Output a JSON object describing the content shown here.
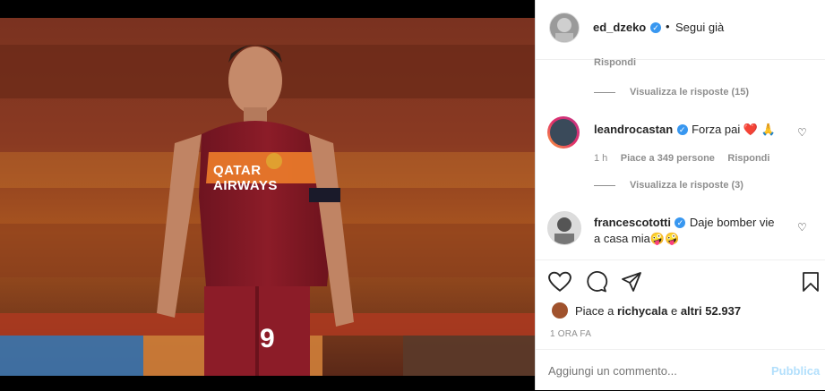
{
  "post": {
    "author": "ed_dzeko",
    "dot": "•",
    "follow_status": "Segui già",
    "photo_jersey_sponsor": "QATAR AIRWAYS",
    "photo_number": "9"
  },
  "comments": {
    "top_reply_label": "Rispondi",
    "view_replies_1": "Visualizza le risposte (15)",
    "c1": {
      "user": "leandrocastan",
      "text": "Forza pai ❤️ 🙏",
      "time": "1 h",
      "likes": "Piace a 349 persone",
      "reply": "Rispondi"
    },
    "view_replies_2": "Visualizza le risposte (3)",
    "c2": {
      "user": "francescototti",
      "text_line1": "Daje bomber vie",
      "text_line2": "a casa mia🤪🤪"
    }
  },
  "likes": {
    "prefix": "Piace a ",
    "user": "richycala",
    "middle": " e ",
    "others": "altri 52.937"
  },
  "timestamp": "1 ORA FA",
  "add_comment": {
    "placeholder": "Aggiungi un commento...",
    "publish": "Pubblica"
  },
  "colors": {
    "accent": "#0095f6",
    "accent_disabled": "#b2dffc",
    "heart": "#ed4956",
    "verified": "#3897f0"
  }
}
